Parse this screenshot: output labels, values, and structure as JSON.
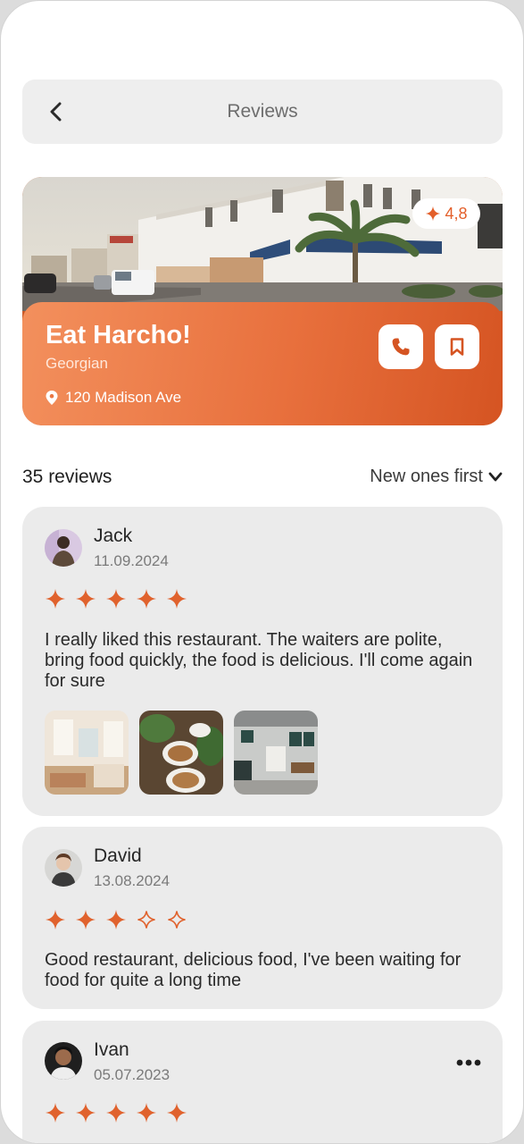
{
  "header": {
    "title": "Reviews",
    "back_icon": "chevron-left-icon"
  },
  "restaurant": {
    "name": "Eat Harcho!",
    "cuisine": "Georgian",
    "address": "120 Madison Ave",
    "rating": "4,8",
    "accent_color": "#e8703d",
    "actions": [
      {
        "icon": "phone-icon"
      },
      {
        "icon": "bookmark-icon"
      }
    ]
  },
  "reviews_bar": {
    "count_label": "35 reviews",
    "sort_label": "New ones first",
    "sort_icon": "chevron-down-icon"
  },
  "reviews": [
    {
      "name": "Jack",
      "date": "11.09.2024",
      "rating": 5,
      "text": "I really liked this restaurant. The waiters are polite, bring food quickly, the food is delicious. I'll come again for sure",
      "photos": [
        "cafe-interior-photo",
        "coffee-cups-photo",
        "cafe-counter-photo"
      ]
    },
    {
      "name": "David",
      "date": "13.08.2024",
      "rating": 3,
      "text": "Good restaurant, delicious food, I've been waiting for food for quite a long time"
    },
    {
      "name": "Ivan",
      "date": "05.07.2023",
      "rating": 5,
      "more_icon": "more-dots-icon"
    }
  ]
}
